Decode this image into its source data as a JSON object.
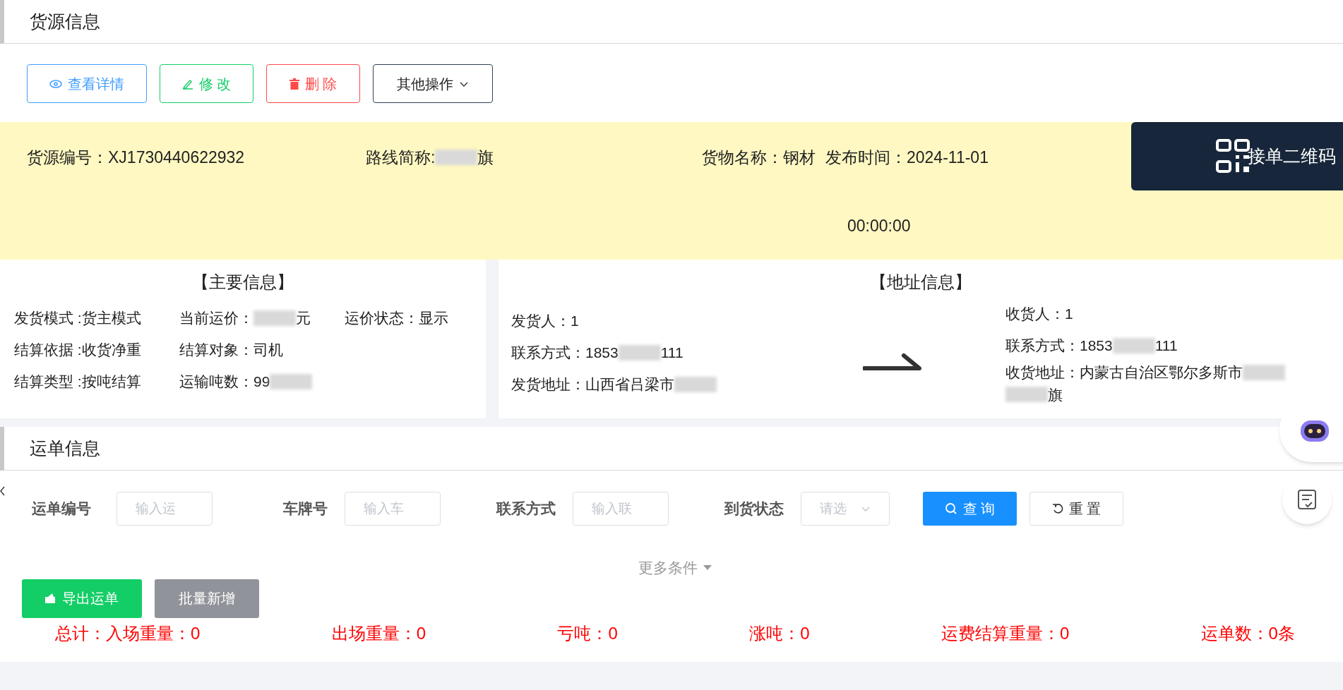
{
  "cargo_section": {
    "title": "货源信息"
  },
  "actions": [
    {
      "kind": "view",
      "label": "查看详情"
    },
    {
      "kind": "edit",
      "label": "修 改"
    },
    {
      "kind": "delete",
      "label": "删 除"
    },
    {
      "kind": "more",
      "label": "其他操作"
    }
  ],
  "summary": {
    "fields": [
      {
        "label": "货源编号：",
        "value": [
          {
            "kind": "text",
            "text": "XJ1730440622932"
          }
        ]
      },
      {
        "label": "路线简称:",
        "value": [
          {
            "kind": "blur"
          },
          {
            "kind": "text",
            "text": "旗"
          }
        ]
      },
      {
        "label": "货物名称：",
        "value": [
          {
            "kind": "text",
            "text": "钢材"
          }
        ]
      },
      {
        "label": "发布时间：",
        "value": [
          {
            "kind": "text",
            "text": "2024-11-01"
          }
        ]
      }
    ],
    "time": "00:00:00",
    "qr_button": "接单二维码"
  },
  "main_info": {
    "title": "【主要信息】",
    "rows": [
      [
        {
          "label": "发货模式 :",
          "value": [
            {
              "kind": "text",
              "text": "货主模式"
            }
          ]
        },
        {
          "label": "当前运价：",
          "value": [
            {
              "kind": "blur"
            },
            {
              "kind": "text",
              "text": "元"
            }
          ]
        },
        {
          "label": "运价状态：",
          "value": [
            {
              "kind": "text",
              "text": "显示"
            }
          ]
        }
      ],
      [
        {
          "label": "结算依据 :",
          "value": [
            {
              "kind": "text",
              "text": "收货净重"
            }
          ]
        },
        {
          "label": "结算对象：",
          "value": [
            {
              "kind": "text",
              "text": "司机"
            }
          ]
        }
      ],
      [
        {
          "label": "结算类型 :",
          "value": [
            {
              "kind": "text",
              "text": "按吨结算"
            }
          ]
        },
        {
          "label": "运输吨数：",
          "value": [
            {
              "kind": "text",
              "text": "99"
            },
            {
              "kind": "blur"
            }
          ]
        }
      ]
    ]
  },
  "address_info": {
    "title": "【地址信息】",
    "sender": [
      {
        "label": "发货人：",
        "value": [
          {
            "kind": "text",
            "text": "1"
          }
        ]
      },
      {
        "label": "联系方式：",
        "value": [
          {
            "kind": "text",
            "text": "1853"
          },
          {
            "kind": "blur"
          },
          {
            "kind": "text",
            "text": "111"
          }
        ]
      },
      {
        "label": "发货地址：",
        "value": [
          {
            "kind": "text",
            "text": "山西省吕梁市"
          },
          {
            "kind": "blur"
          }
        ]
      }
    ],
    "receiver": [
      {
        "label": "收货人：",
        "value": [
          {
            "kind": "text",
            "text": "1"
          }
        ]
      },
      {
        "label": "联系方式：",
        "value": [
          {
            "kind": "text",
            "text": "1853"
          },
          {
            "kind": "blur"
          },
          {
            "kind": "text",
            "text": "111"
          }
        ]
      },
      {
        "label": "收货地址：",
        "value": [
          {
            "kind": "text",
            "text": "内蒙古自治区鄂尔多斯市"
          },
          {
            "kind": "blur"
          },
          {
            "kind": "blur"
          },
          {
            "kind": "text",
            "text": "旗"
          }
        ]
      }
    ]
  },
  "waybill_section": {
    "title": "运单信息"
  },
  "filters": [
    {
      "kind": "input",
      "label": "运单编号",
      "placeholder": "输入运"
    },
    {
      "kind": "input",
      "label": "车牌号",
      "placeholder": "输入车"
    },
    {
      "kind": "input",
      "label": "联系方式",
      "placeholder": "输入联"
    },
    {
      "kind": "select",
      "label": "到货状态",
      "placeholder": "请选"
    }
  ],
  "search_button": "查 询",
  "reset_button": "重 置",
  "more_conditions": "更多条件",
  "list_actions": [
    {
      "kind": "export",
      "label": "导出运单",
      "disabled": false
    },
    {
      "kind": "batch",
      "label": "批量新增",
      "disabled": true
    }
  ],
  "totals": [
    "总计：入场重量：0",
    "出场重量：0",
    "亏吨：0",
    "涨吨：0",
    "运费结算重量：0",
    "运单数：0条"
  ]
}
